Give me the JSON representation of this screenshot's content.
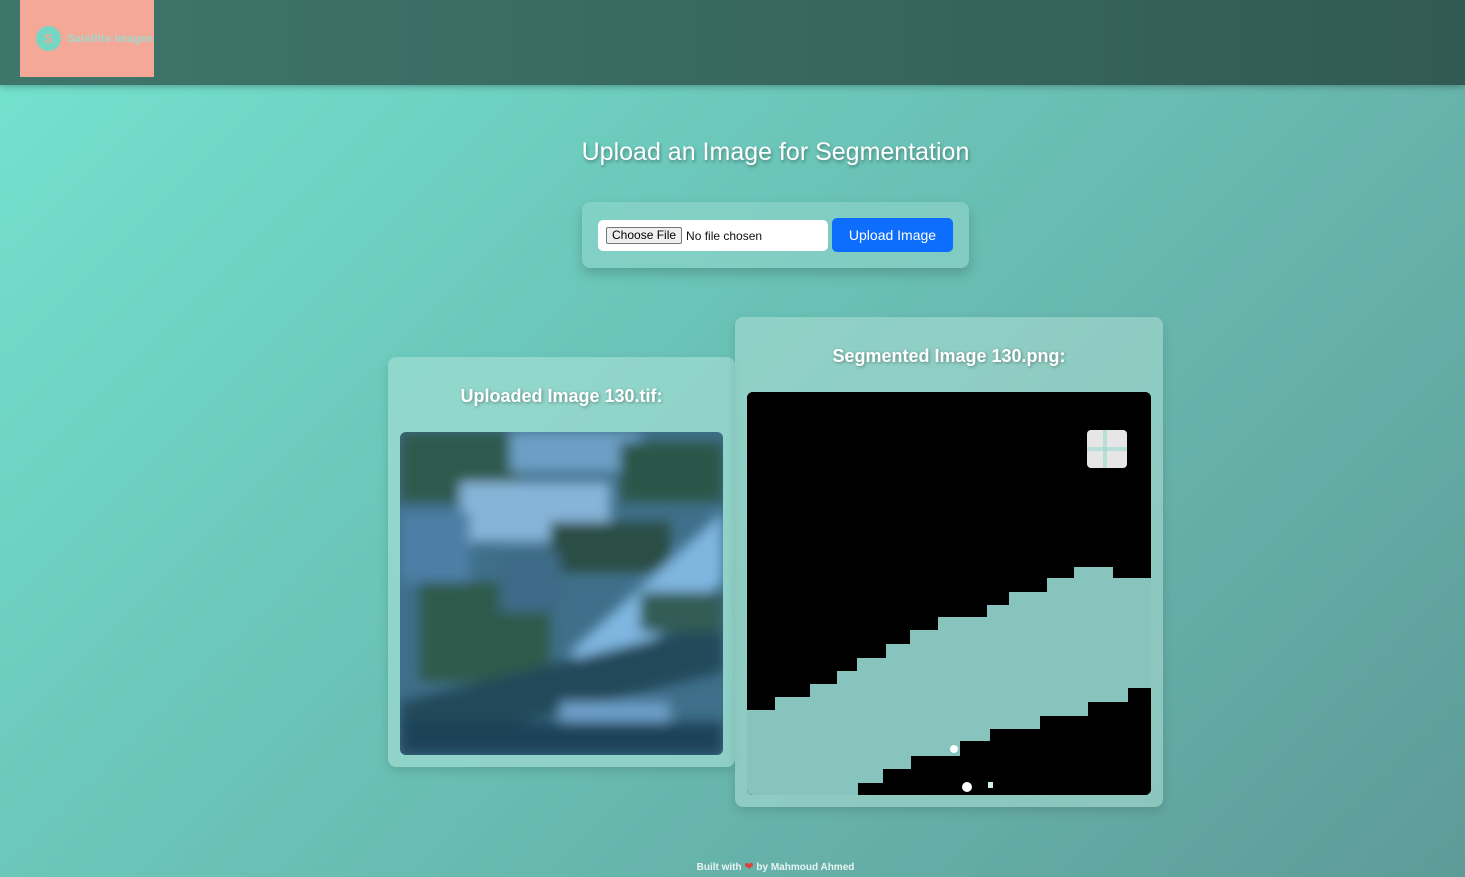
{
  "header": {
    "logo_mark": "S",
    "logo_text": "Satellite Images"
  },
  "main": {
    "title": "Upload an Image for Segmentation",
    "upload": {
      "choose_label": "Choose File",
      "file_status": "No file chosen",
      "upload_label": "Upload Image"
    },
    "uploaded_card": {
      "title": "Uploaded Image 130.tif:"
    },
    "segmented_card": {
      "title": "Segmented Image 130.png:"
    }
  },
  "footer": {
    "prefix": "Built with",
    "heart_icon": "heart-icon",
    "suffix": "by Mahmoud Ahmed"
  },
  "colors": {
    "primary_button": "#0d6efd",
    "logo_bg": "#f4a897",
    "mask_fill": "#86c4bd"
  }
}
